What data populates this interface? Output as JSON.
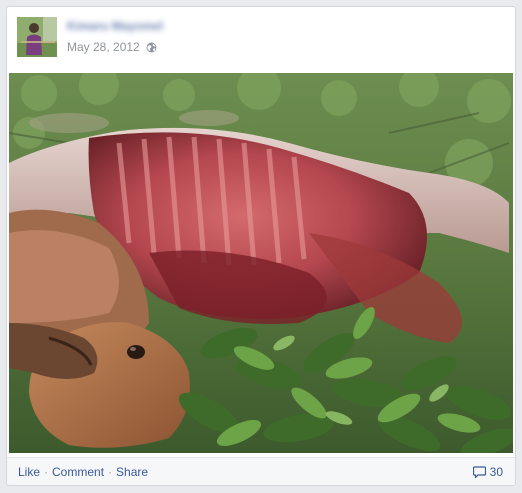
{
  "post": {
    "author_name": "Kimaru Mayomel",
    "date": "May 28, 2012",
    "privacy_icon": "globe-icon"
  },
  "photo": {
    "icon": "photo-content"
  },
  "footer": {
    "like_label": "Like",
    "comment_label": "Comment",
    "share_label": "Share",
    "separator": "·",
    "comment_count": "30",
    "comment_icon": "speech-bubble-icon"
  },
  "colors": {
    "link": "#3b5998",
    "meta": "#90949c",
    "footer_bg": "#f6f7f9"
  }
}
